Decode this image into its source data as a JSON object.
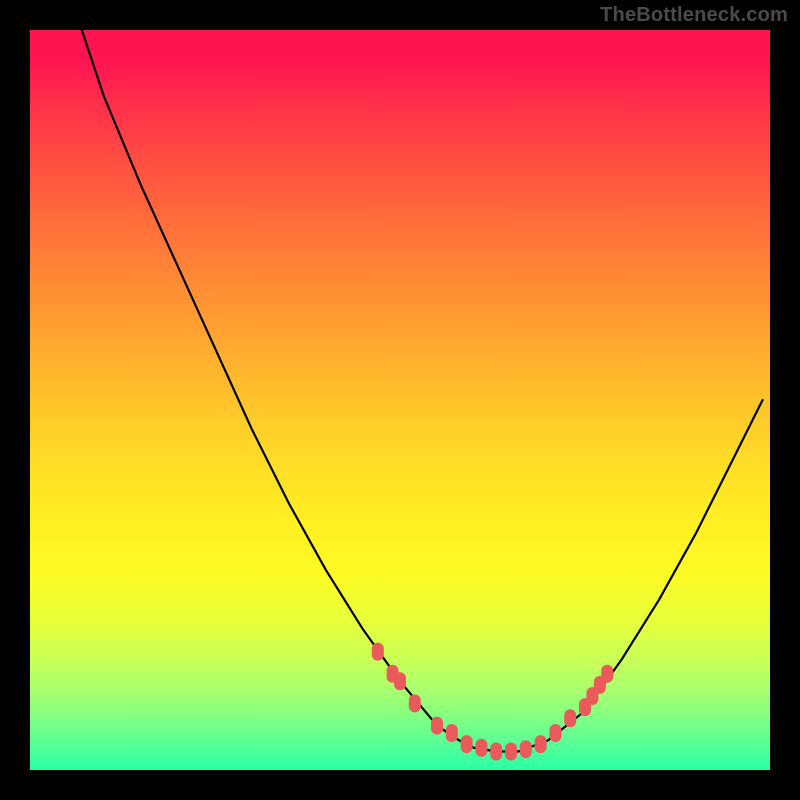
{
  "watermark": "TheBottleneck.com",
  "colors": {
    "background": "#000000",
    "curve": "#000000",
    "marker": "#ef6e6e",
    "gradient_top": "#ff1452",
    "gradient_mid": "#ffe126",
    "gradient_bottom": "#2affa6"
  },
  "chart_data": {
    "type": "line",
    "title": "",
    "xlabel": "",
    "ylabel": "",
    "xlim": [
      0,
      100
    ],
    "ylim": [
      0,
      100
    ],
    "grid": false,
    "legend": false,
    "series": [
      {
        "name": "bottleneck-curve",
        "x": [
          7,
          10,
          15,
          20,
          25,
          30,
          35,
          40,
          45,
          50,
          55,
          58,
          60,
          63,
          66,
          70,
          75,
          80,
          85,
          90,
          95,
          99
        ],
        "values": [
          100,
          91,
          79,
          68,
          57,
          46,
          36,
          27,
          19,
          12,
          6,
          4,
          3,
          2.5,
          2.5,
          4,
          8,
          15,
          23,
          32,
          42,
          50
        ]
      }
    ],
    "markers": {
      "name": "highlighted-points",
      "x": [
        47,
        49,
        50,
        52,
        55,
        57,
        59,
        61,
        63,
        65,
        67,
        69,
        71,
        73,
        75,
        76,
        77,
        78
      ],
      "values": [
        16,
        13,
        12,
        9,
        6,
        5,
        3.5,
        3,
        2.5,
        2.5,
        2.8,
        3.5,
        5,
        7,
        8.5,
        10,
        11.5,
        13
      ]
    }
  }
}
